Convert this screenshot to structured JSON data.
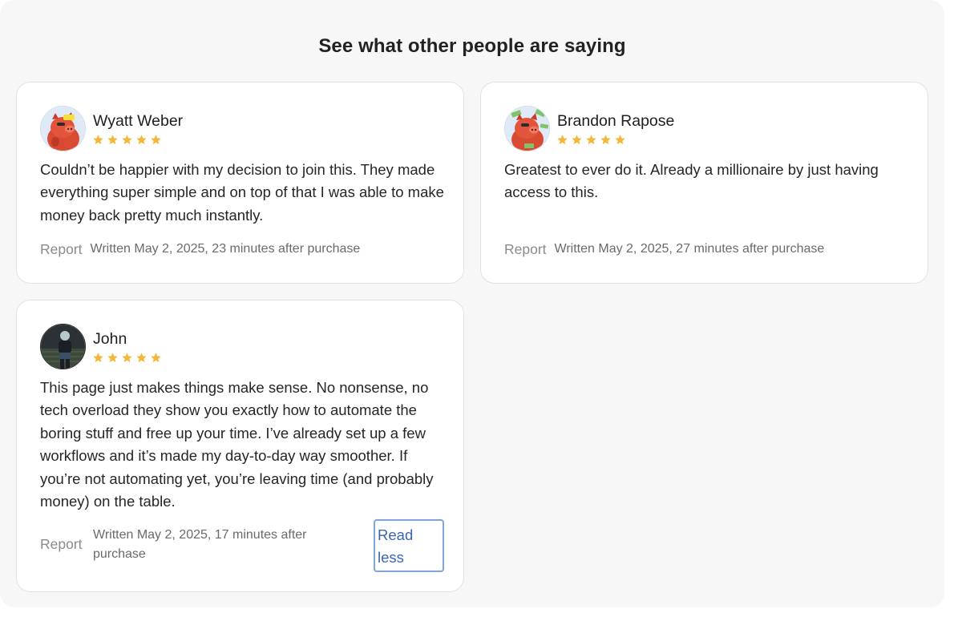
{
  "section": {
    "heading": "See what other people are saying"
  },
  "colors": {
    "star": "#f2b83a",
    "link": "#3a66b0",
    "link_border": "#7fa6dc"
  },
  "reviews": [
    {
      "name": "Wyatt Weber",
      "rating": 5,
      "avatar_icon": "red-pig-cartoon-avatar",
      "text": "Couldn’t be happier with my decision to join this. They made everything super simple and on top of that I was able to make money back pretty much instantly.",
      "report_label": "Report",
      "written": "Written May 2, 2025, 23 minutes after purchase"
    },
    {
      "name": "Brandon Rapose",
      "rating": 5,
      "avatar_icon": "red-pig-money-cartoon-avatar",
      "text": "Greatest to ever do it. Already a millionaire by just having access to this.",
      "report_label": "Report",
      "written": "Written May 2, 2025, 27 minutes after purchase"
    },
    {
      "name": "John",
      "rating": 5,
      "avatar_icon": "person-photo-avatar",
      "text": "This page just makes things make sense. No nonsense, no tech overload they show you exactly how to automate the boring stuff and free up your time. I’ve already set up a few workflows and it’s made my day-to-day way smoother. If you’re not automating yet, you’re leaving time (and probably money) on the table.",
      "report_label": "Report",
      "written": "Written May 2, 2025, 17 minutes after purchase",
      "toggle_label": "Read less"
    }
  ]
}
